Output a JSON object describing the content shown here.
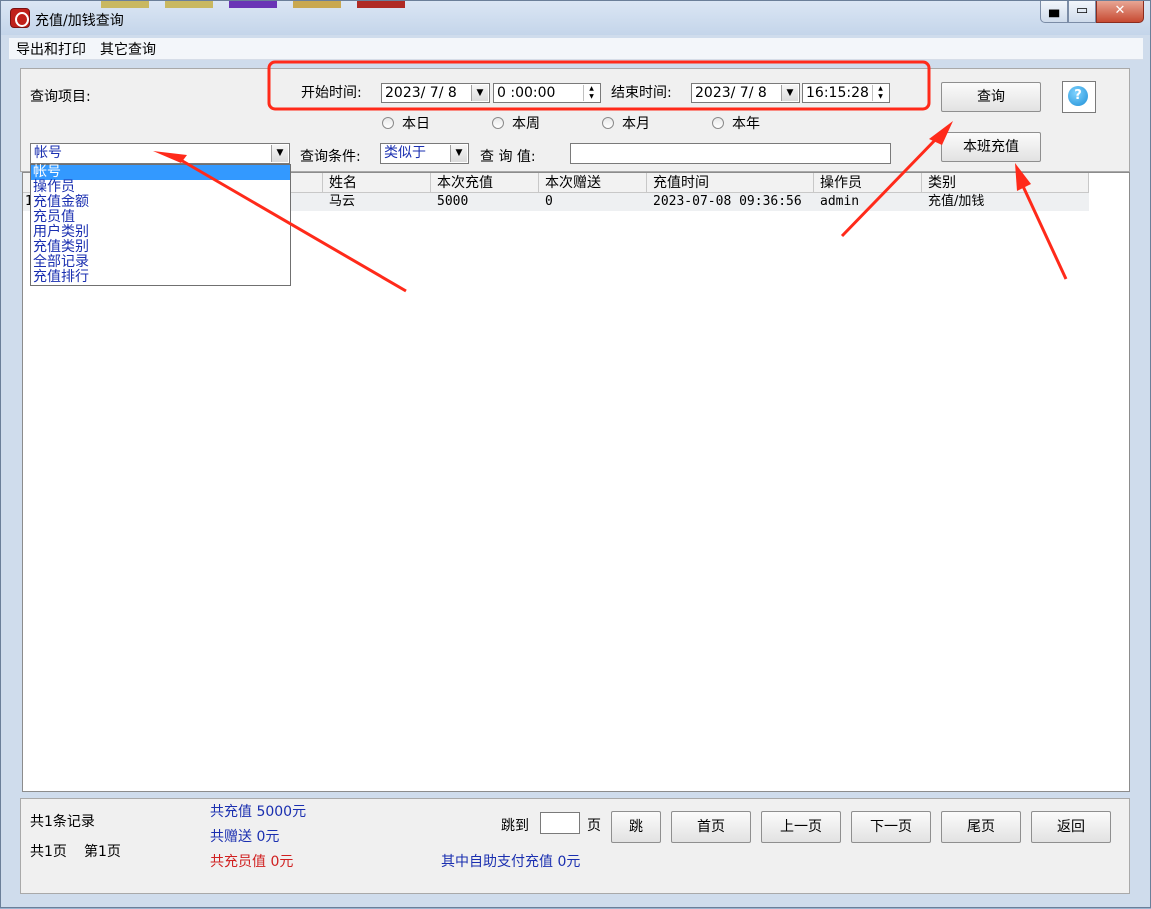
{
  "window": {
    "title": "充值/加钱查询",
    "controls": [
      "minimize",
      "maximize",
      "close"
    ]
  },
  "menu": [
    "导出和打印",
    "其它查询"
  ],
  "query": {
    "item_label": "查询项目:",
    "start_label": "开始时间:",
    "start_date": "2023/ 7/ 8",
    "start_time": "0 :00:00",
    "end_label": "结束时间:",
    "end_date": "2023/ 7/ 8",
    "end_time": "16:15:28",
    "periods": [
      "本日",
      "本周",
      "本月",
      "本年"
    ],
    "field_value": "帐号",
    "condition_label": "查询条件:",
    "condition_value": "类似于",
    "value_label": "查 询 值:",
    "search_value": "",
    "search_button": "查询",
    "shift_button": "本班充值",
    "help_icon": "?"
  },
  "field_options": [
    "帐号",
    "操作员",
    "充值金额",
    "充员值",
    "用户类别",
    "充值类别",
    "全部记录",
    "充值排行"
  ],
  "grid": {
    "columns": [
      "",
      "",
      "姓名",
      "本次充值",
      "本次赠送",
      "充值时间",
      "操作员",
      "类别"
    ],
    "rows": [
      [
        "1",
        "",
        "马云",
        "5000",
        "0",
        "2023-07-08 09:36:56",
        "admin",
        "充值/加钱"
      ]
    ]
  },
  "footer": {
    "record_count": "共1条记录",
    "total_pages": "共1页",
    "current_page": "第1页",
    "total_recharge": "共充值 5000元",
    "total_gift": "共赠送 0元",
    "total_member_value": "共充员值 0元",
    "self_pay": "其中自助支付充值 0元",
    "jump_label": "跳到",
    "page_unit": "页",
    "jump_input": "",
    "jump_button": "跳",
    "first_button": "首页",
    "prev_button": "上一页",
    "next_button": "下一页",
    "last_button": "尾页",
    "back_button": "返回"
  },
  "colors": {
    "annotation_red": "#ff2a1a",
    "summary_blue": "#1a2fb0",
    "summary_red": "#d02020",
    "selection_blue": "#3399ff"
  }
}
